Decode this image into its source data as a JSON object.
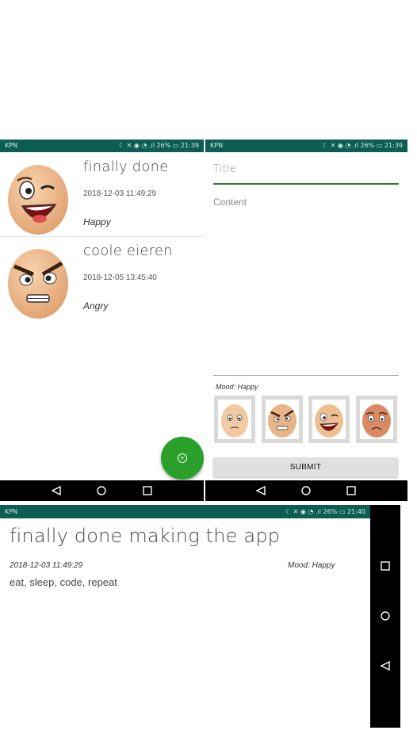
{
  "status": {
    "carrier": "KPN",
    "battery": "26%",
    "time_list": "21:39",
    "time_form": "21:39",
    "time_detail": "21:40"
  },
  "list": {
    "items": [
      {
        "title": "finally done",
        "date": "2018-12-03 11:49:29",
        "mood": "Happy",
        "face": "happy-egg-icon"
      },
      {
        "title": "coole eieren",
        "date": "2018-12-05 13:45:40",
        "mood": "Angry",
        "face": "angry-egg-icon"
      }
    ],
    "fab_icon": "add-icon"
  },
  "form": {
    "title_placeholder": "Title",
    "content_placeholder": "Content",
    "mood_label": "Mood: Happy",
    "submit_label": "SUBMIT",
    "moods": [
      "neutral-egg-icon",
      "angry-egg-icon",
      "happy-egg-icon",
      "sad-egg-icon"
    ]
  },
  "detail": {
    "title": "finally done making the app",
    "date": "2018-12-03 11:49:29",
    "mood": "Mood: Happy",
    "content": "eat, sleep, code, repeat"
  },
  "colors": {
    "statusbar": "#0d5e52",
    "accent": "#2e7d32",
    "fab": "#2aa02a"
  }
}
